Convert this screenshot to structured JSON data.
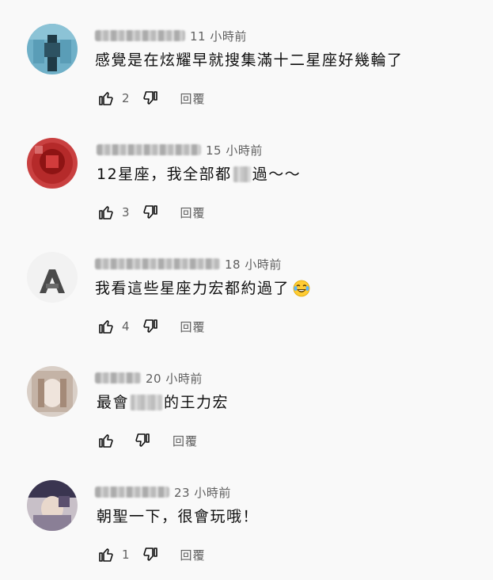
{
  "colors": {
    "background": "#f9f9f9",
    "text": "#0f0f0f",
    "secondary": "#606060"
  },
  "icons": {
    "like": "thumb-up-icon",
    "dislike": "thumb-down-icon",
    "emoji": "laughing-tears-emoji"
  },
  "comments": [
    {
      "time": "11 小時前",
      "text": "感覺是在炫耀早就搜集滿十二星座好幾輪了",
      "likes": "2",
      "reply": "回覆"
    },
    {
      "time": "15 小時前",
      "text_before": "12星座，我全部都",
      "text_after": "過～～",
      "likes": "3",
      "reply": "回覆"
    },
    {
      "time": "18 小時前",
      "text": "我看這些星座力宏都約過了",
      "likes": "4",
      "reply": "回覆"
    },
    {
      "time": "20 小時前",
      "text_before": "最會",
      "text_after": "的王力宏",
      "likes": "",
      "reply": "回覆"
    },
    {
      "time": "23 小時前",
      "text": "朝聖一下，很會玩哦！",
      "likes": "1",
      "reply": "回覆"
    }
  ]
}
